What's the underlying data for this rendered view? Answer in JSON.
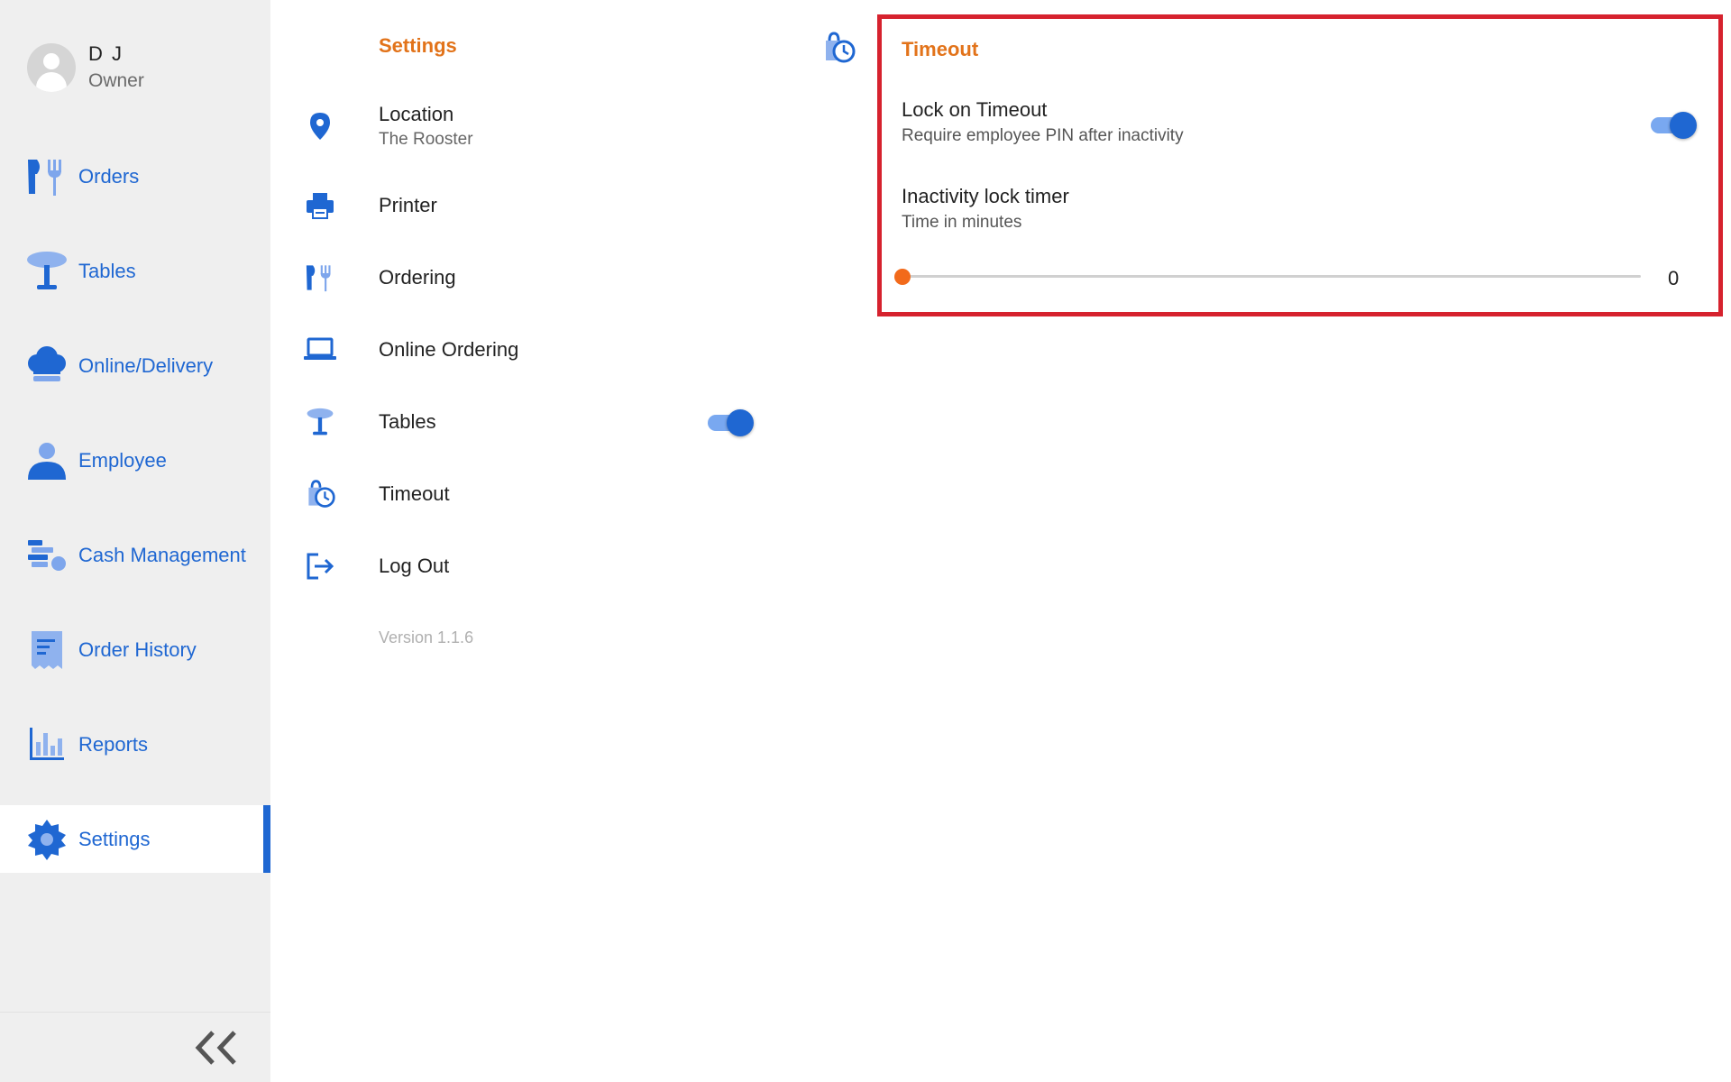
{
  "user": {
    "name": "D J",
    "role": "Owner"
  },
  "sidebar": {
    "items": [
      {
        "label": "Orders",
        "icon": "orders-icon"
      },
      {
        "label": "Tables",
        "icon": "table-icon"
      },
      {
        "label": "Online/Delivery",
        "icon": "chef-hat-icon"
      },
      {
        "label": "Employee",
        "icon": "person-icon"
      },
      {
        "label": "Cash Management",
        "icon": "cash-icon"
      },
      {
        "label": "Order History",
        "icon": "receipt-icon"
      },
      {
        "label": "Reports",
        "icon": "bar-chart-icon"
      },
      {
        "label": "Settings",
        "icon": "gear-icon",
        "active": true
      }
    ],
    "collapse_icon": "double-chevron-left-icon"
  },
  "settings": {
    "title": "Settings",
    "header_icon": "timeout-icon",
    "menu": [
      {
        "label": "Location",
        "sub": "The Rooster",
        "icon": "location-pin-icon"
      },
      {
        "label": "Printer",
        "icon": "printer-icon"
      },
      {
        "label": "Ordering",
        "icon": "orders-icon"
      },
      {
        "label": "Online Ordering",
        "icon": "laptop-icon"
      },
      {
        "label": "Tables",
        "icon": "table-icon",
        "toggle_on": true
      },
      {
        "label": "Timeout",
        "icon": "timeout-icon"
      },
      {
        "label": "Log Out",
        "icon": "logout-icon"
      }
    ],
    "version": "Version 1.1.6"
  },
  "timeout_panel": {
    "title": "Timeout",
    "lock_on_timeout": {
      "label": "Lock on Timeout",
      "sub": "Require employee PIN after inactivity",
      "enabled": true
    },
    "inactivity_timer": {
      "label": "Inactivity lock timer",
      "sub": "Time in minutes",
      "value": "0"
    }
  },
  "colors": {
    "accent_blue": "#1f67d2",
    "title_orange": "#e2731a",
    "slider_orange": "#f26a1b",
    "highlight_red": "#d6222e",
    "sidebar_bg": "#efefef"
  }
}
